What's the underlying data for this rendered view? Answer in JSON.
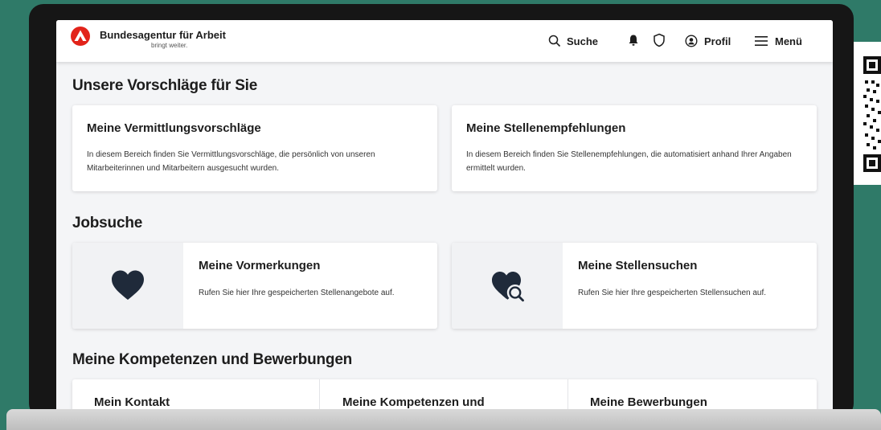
{
  "header": {
    "brand_name": "Bundesagentur für Arbeit",
    "brand_tagline": "bringt weiter.",
    "search_label": "Suche",
    "profile_label": "Profil",
    "menu_label": "Menü"
  },
  "suggestions": {
    "title": "Unsere Vorschläge für Sie",
    "cards": [
      {
        "title": "Meine Vermittlungsvorschläge",
        "text": "In diesem Bereich finden Sie Vermittlungsvorschläge, die persönlich von unseren Mitarbeiterinnen und Mitarbeitern ausgesucht wurden."
      },
      {
        "title": "Meine Stellenempfehlungen",
        "text": "In diesem Bereich finden Sie Stellenempfehlungen, die automatisiert anhand Ihrer Angaben ermittelt wurden."
      }
    ]
  },
  "jobsearch": {
    "title": "Jobsuche",
    "cards": [
      {
        "title": "Meine Vormerkungen",
        "text": "Rufen Sie hier Ihre gespeicherten Stellenangebote auf."
      },
      {
        "title": "Meine Stellensuchen",
        "text": "Rufen Sie hier Ihre gespeicherten Stellensuchen auf."
      }
    ]
  },
  "competences": {
    "title": "Meine Kompetenzen und Bewerbungen",
    "cards": [
      {
        "title": "Mein Kontakt"
      },
      {
        "title": "Meine Kompetenzen und"
      },
      {
        "title": "Meine Bewerbungen"
      }
    ]
  },
  "icons": {
    "logo": "ba-logo-icon",
    "search": "search-icon",
    "notifications": "bell-icon",
    "privacy": "shield-icon",
    "profile": "user-circle-icon",
    "menu": "hamburger-icon",
    "saved": "heart-icon",
    "saved_search": "heart-search-icon",
    "qr": "qr-code"
  },
  "colors": {
    "background": "#2f7a68",
    "brand_red": "#e2231a",
    "text": "#1d1d1d",
    "icon_dark": "#1f2a3a"
  }
}
